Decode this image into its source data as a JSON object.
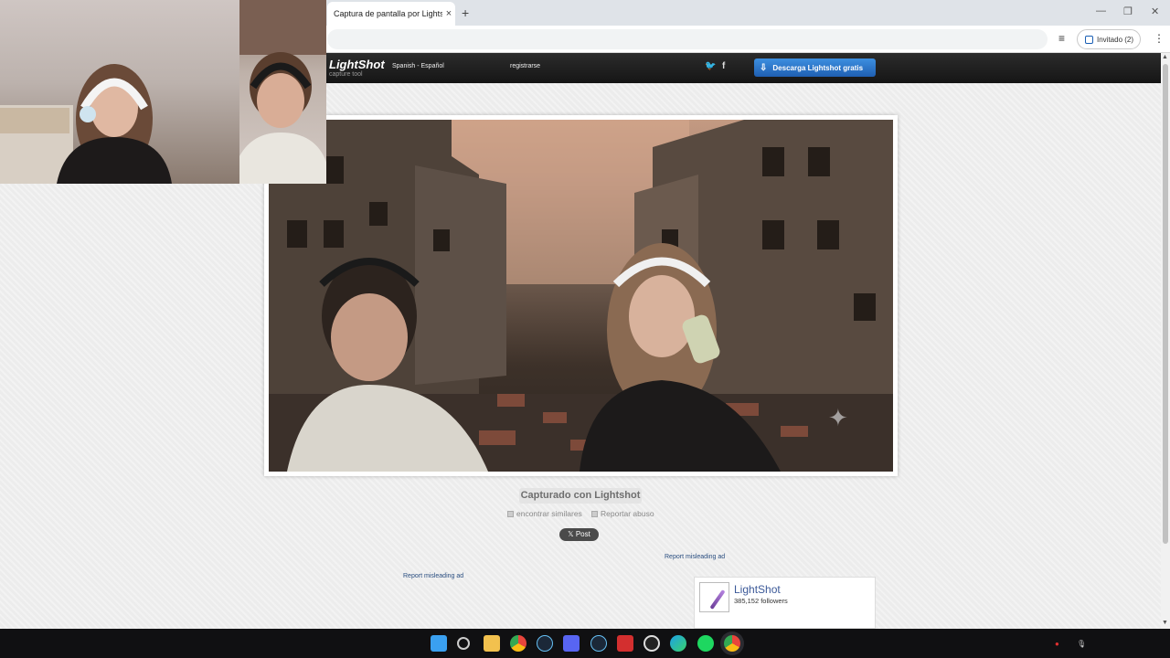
{
  "browser": {
    "tab_title": "Captura de pantalla por Lightshot",
    "tab_close": "×",
    "new_tab": "+",
    "profile_label": "Invitado (2)",
    "menu": "⋮",
    "minimize": "—",
    "restore": "❐",
    "close": "✕",
    "reading_list_icon": "≡"
  },
  "lightshot": {
    "logo": "LightShot",
    "tagline": "capture tool",
    "language": "Spanish - Español",
    "register": "registrarse",
    "twitter": "🐦",
    "facebook": "f",
    "download": "Descarga Lightshot gratis"
  },
  "page": {
    "captured_label": "Capturado con Lightshot",
    "find_similar": "encontrar similares",
    "report_abuse": "Reportar abuso",
    "post_button": "𝕏 Post",
    "report_ad_1": "Report misleading ad",
    "report_ad_2": "Report misleading ad"
  },
  "facebook_box": {
    "name": "LightShot",
    "followers": "385,152 followers"
  },
  "taskbar": {
    "items": [
      "windows-start",
      "search",
      "file-explorer",
      "chrome",
      "steam",
      "discord",
      "steam-2",
      "voicemod",
      "obs",
      "edge",
      "spotify",
      "chrome-active"
    ],
    "colors": {
      "windows": "#3aa0f0",
      "explorer": "#f2c14e",
      "chrome": "#e8453c",
      "steam": "#1b2838",
      "discord": "#5865f2",
      "spotify": "#1ed760",
      "edge": "#1da1e8",
      "voice": "#d32f2f",
      "obs": "#222222"
    }
  },
  "colors": {
    "download_button": "#2a74cf",
    "lightshot_bar": "#1e1e1e",
    "link": "#2a4e80"
  }
}
